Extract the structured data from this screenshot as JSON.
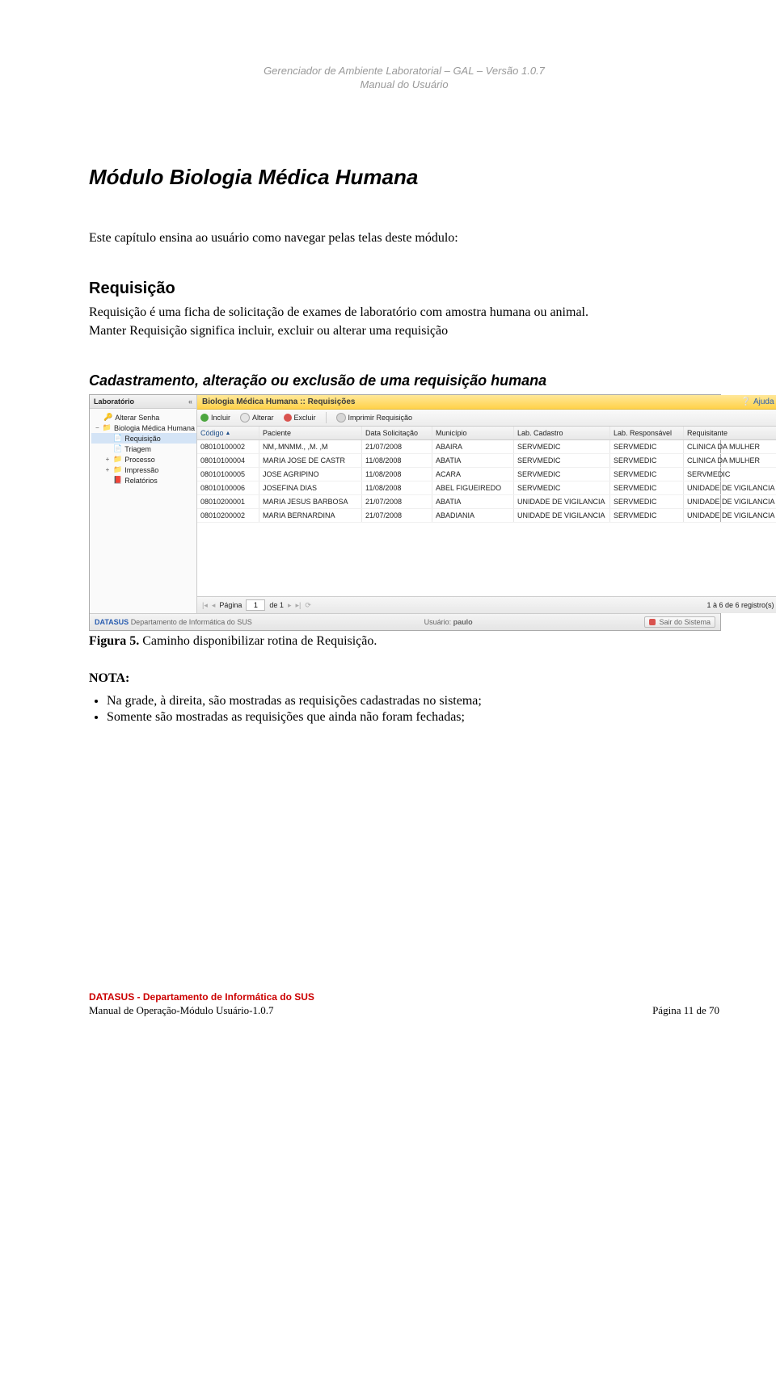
{
  "header": {
    "line1": "Gerenciador de Ambiente Laboratorial – GAL – Versão 1.0.7",
    "line2": "Manual do Usuário"
  },
  "h1": "Módulo Biologia Médica Humana",
  "p1": "Este capítulo ensina ao usuário como navegar pelas telas deste módulo:",
  "h2": "Requisição",
  "p2": "Requisição é uma ficha de solicitação de exames de laboratório com amostra humana ou animal.",
  "p3": "Manter Requisição significa incluir, excluir ou alterar uma requisição",
  "h3": "Cadastramento, alteração ou exclusão de uma requisição humana",
  "caption": {
    "bold": "Figura 5.",
    "rest": " Caminho disponibilizar rotina de Requisição."
  },
  "nota_label": "NOTA:",
  "notes": [
    "Na grade, à direita, são mostradas as requisições cadastradas no sistema;",
    "Somente são mostradas as requisições que ainda não foram fechadas;"
  ],
  "footer": {
    "red": "DATASUS - Departamento de Informática do SUS",
    "line": "Manual de Operação-Módulo Usuário-1.0.7",
    "page": "Página 11 de 70"
  },
  "shot": {
    "sidebar": {
      "title": "Laboratório",
      "items": [
        {
          "icon": "key",
          "exp": "",
          "lvl": 1,
          "label": "Alterar Senha"
        },
        {
          "icon": "fold",
          "exp": "−",
          "lvl": 1,
          "label": "Biologia Médica Humana"
        },
        {
          "icon": "doc",
          "exp": "",
          "lvl": 2,
          "label": "Requisição",
          "selected": true
        },
        {
          "icon": "doc",
          "exp": "",
          "lvl": 2,
          "label": "Triagem"
        },
        {
          "icon": "fold",
          "exp": "+",
          "lvl": 2,
          "label": "Processo"
        },
        {
          "icon": "fold",
          "exp": "+",
          "lvl": 2,
          "label": "Impressão"
        },
        {
          "icon": "docr",
          "exp": "",
          "lvl": 2,
          "label": "Relatórios"
        }
      ]
    },
    "crumb": "Biologia Médica Humana :: Requisições",
    "ajuda": "Ajuda",
    "toolbar": {
      "incluir": "Incluir",
      "alterar": "Alterar",
      "excluir": "Excluir",
      "imprimir": "Imprimir Requisição"
    },
    "columns": {
      "codigo": "Código",
      "paciente": "Paciente",
      "data": "Data Solicitação",
      "municipio": "Município",
      "labcad": "Lab. Cadastro",
      "labresp": "Lab. Responsável",
      "requisitante": "Requisitante"
    },
    "rows": [
      {
        "codigo": "08010100002",
        "paciente": "NM,.MNMM., ,M. ,M",
        "data": "21/07/2008",
        "municipio": "ABAIRA",
        "labcad": "SERVMEDIC",
        "labresp": "SERVMEDIC",
        "requisitante": "CLINICA DA MULHER"
      },
      {
        "codigo": "08010100004",
        "paciente": "MARIA JOSE DE CASTR",
        "data": "11/08/2008",
        "municipio": "ABATIA",
        "labcad": "SERVMEDIC",
        "labresp": "SERVMEDIC",
        "requisitante": "CLINICA DA MULHER"
      },
      {
        "codigo": "08010100005",
        "paciente": "JOSE AGRIPINO",
        "data": "11/08/2008",
        "municipio": "ACARA",
        "labcad": "SERVMEDIC",
        "labresp": "SERVMEDIC",
        "requisitante": "SERVMEDIC"
      },
      {
        "codigo": "08010100006",
        "paciente": "JOSEFINA DIAS",
        "data": "11/08/2008",
        "municipio": "ABEL FIGUEIREDO",
        "labcad": "SERVMEDIC",
        "labresp": "SERVMEDIC",
        "requisitante": "UNIDADE DE VIGILANCIA"
      },
      {
        "codigo": "08010200001",
        "paciente": "MARIA JESUS BARBOSA",
        "data": "21/07/2008",
        "municipio": "ABATIA",
        "labcad": "UNIDADE DE VIGILANCIA",
        "labresp": "SERVMEDIC",
        "requisitante": "UNIDADE DE VIGILANCIA"
      },
      {
        "codigo": "08010200002",
        "paciente": "MARIA BERNARDINA",
        "data": "21/07/2008",
        "municipio": "ABADIANIA",
        "labcad": "UNIDADE DE VIGILANCIA",
        "labresp": "SERVMEDIC",
        "requisitante": "UNIDADE DE VIGILANCIA"
      }
    ],
    "pager": {
      "label_pagina": "Página",
      "value": "1",
      "label_de": "de 1",
      "status": "1 à 6 de 6 registro(s)"
    },
    "statusbar": {
      "brand": "DATASUS",
      "dept": "Departamento de Informática do SUS",
      "user_label": "Usuário:",
      "user_value": "paulo",
      "logout": "Sair do Sistema"
    }
  }
}
